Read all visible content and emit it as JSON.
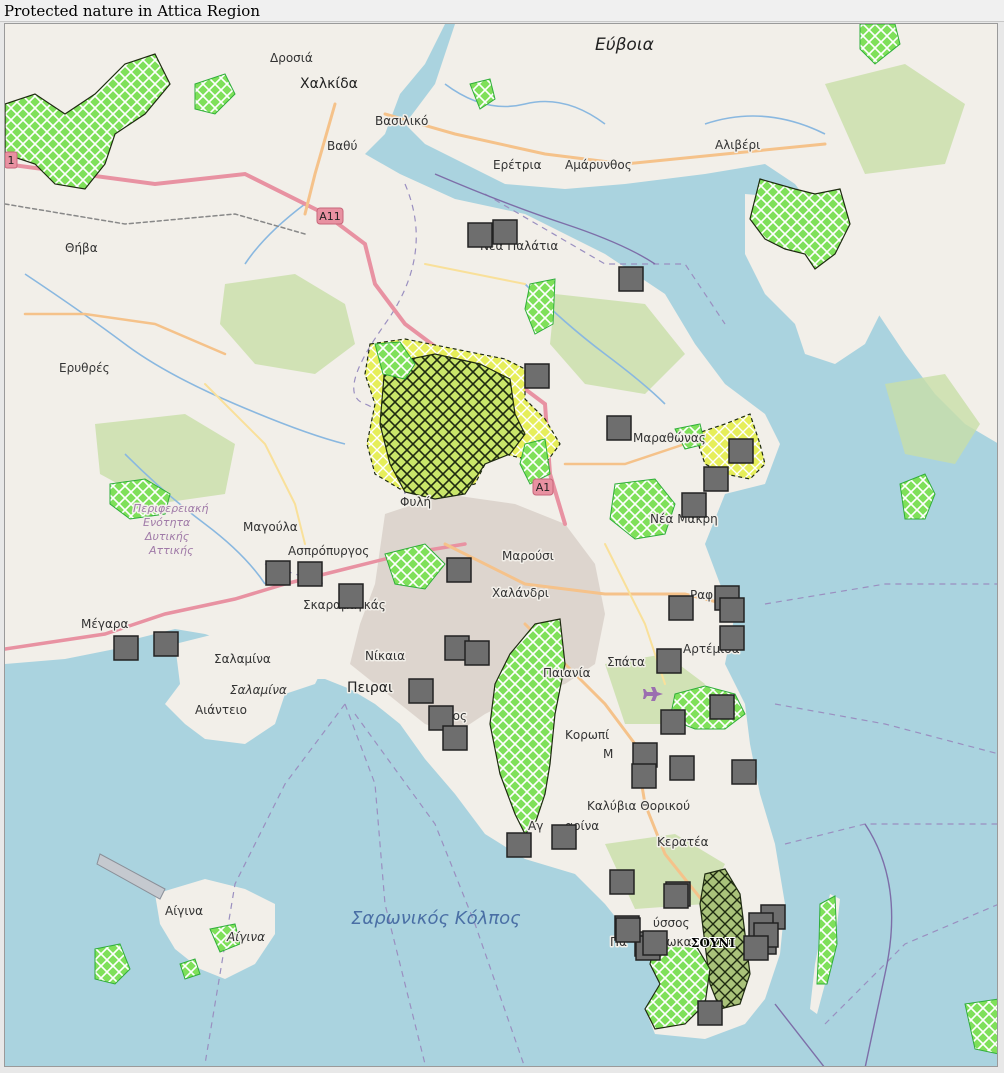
{
  "title": "Protected nature in Attica Region",
  "colors": {
    "sea": "#aad3df",
    "land": "#f2efe9",
    "forest": "#c8dfa8",
    "urban": "#d9d0c9",
    "protected_green": "#7fe05a",
    "protected_yellow": "#eef07a",
    "protected_olive": "#a9c27a",
    "motorway": "#e892a2",
    "marker": "#6e6e6e"
  },
  "map": {
    "place_labels": [
      {
        "id": "evia",
        "text": "Εύβοια",
        "kind": "island"
      },
      {
        "id": "chalkida",
        "text": "Χαλκίδα",
        "kind": "town"
      },
      {
        "id": "drosia",
        "text": "Δροσιά",
        "kind": "place"
      },
      {
        "id": "vasiliko",
        "text": "Βασιλικό",
        "kind": "place"
      },
      {
        "id": "vathy",
        "text": "Βαθύ",
        "kind": "place"
      },
      {
        "id": "eretria",
        "text": "Ερέτρια",
        "kind": "place"
      },
      {
        "id": "amarynthos",
        "text": "Αμάρυνθος",
        "kind": "place"
      },
      {
        "id": "alivery",
        "text": "Αλιβέρι",
        "kind": "place"
      },
      {
        "id": "thiva",
        "text": "Θήβα",
        "kind": "place"
      },
      {
        "id": "nea-palatia",
        "text": "Νέα Παλάτια",
        "kind": "place"
      },
      {
        "id": "erythres",
        "text": "Ερυθρές",
        "kind": "place"
      },
      {
        "id": "marathonas",
        "text": "Μαραθώνας",
        "kind": "place"
      },
      {
        "id": "fyli",
        "text": "Φυλή",
        "kind": "place"
      },
      {
        "id": "nea-makri",
        "text": "Νέα Μάκρη",
        "kind": "place"
      },
      {
        "id": "perif-1",
        "text": "Περιφερειακή",
        "kind": "admin"
      },
      {
        "id": "perif-2",
        "text": "Ενότητα",
        "kind": "admin"
      },
      {
        "id": "perif-3",
        "text": "Δυτικής",
        "kind": "admin"
      },
      {
        "id": "perif-4",
        "text": "Αττικής",
        "kind": "admin"
      },
      {
        "id": "magoula",
        "text": "Μαγούλα",
        "kind": "place"
      },
      {
        "id": "aspropyrgos",
        "text": "Ασπρόπυργος",
        "kind": "place"
      },
      {
        "id": "marousi",
        "text": "Μαρούσι",
        "kind": "place"
      },
      {
        "id": "skaramagkas",
        "text": "Σκαραμαγκάς",
        "kind": "place"
      },
      {
        "id": "chalandri",
        "text": "Χαλάνδρι",
        "kind": "place"
      },
      {
        "id": "rafina",
        "text": "Ραφ",
        "kind": "place"
      },
      {
        "id": "megara",
        "text": "Μέγαρα",
        "kind": "place"
      },
      {
        "id": "salamina-town",
        "text": "Σαλαμίνα",
        "kind": "place"
      },
      {
        "id": "salamina-island",
        "text": "Σαλαμίνα",
        "kind": "island-small"
      },
      {
        "id": "nikaia",
        "text": "Νίκαια",
        "kind": "place"
      },
      {
        "id": "spata",
        "text": "Σπάτα",
        "kind": "place"
      },
      {
        "id": "artemida",
        "text": "Αρτέμιδα",
        "kind": "place"
      },
      {
        "id": "peiraias",
        "text": "Πειραι",
        "kind": "town"
      },
      {
        "id": "paiania",
        "text": "Παιανία",
        "kind": "place"
      },
      {
        "id": "aianteio",
        "text": "Αιάντειο",
        "kind": "place"
      },
      {
        "id": "glyfada",
        "text": "μος",
        "kind": "place"
      },
      {
        "id": "koropi",
        "text": "Κορωπί",
        "kind": "place"
      },
      {
        "id": "markopoulo",
        "text": "Μ",
        "kind": "place"
      },
      {
        "id": "kalyvia",
        "text": "Καλύβια Θορικού",
        "kind": "place"
      },
      {
        "id": "anavyssos-nea",
        "text": "Αγ",
        "kind": "place"
      },
      {
        "id": "varkiza",
        "text": "αρίνα",
        "kind": "place"
      },
      {
        "id": "keratea",
        "text": "Κερατέα",
        "kind": "place"
      },
      {
        "id": "saronic",
        "text": "Σαρωνικός Κόλπος",
        "kind": "sea"
      },
      {
        "id": "aigina-town",
        "text": "Αίγινα",
        "kind": "place"
      },
      {
        "id": "aigina-island",
        "text": "Αίγινα",
        "kind": "island-small"
      },
      {
        "id": "anavyssos",
        "text": "ύσσος",
        "kind": "place"
      },
      {
        "id": "palaia-fokaia",
        "text": "Πα",
        "kind": "place"
      },
      {
        "id": "fokaia",
        "text": "Φωκα",
        "kind": "place"
      },
      {
        "id": "sounio",
        "text": "ΣΟΥΝΙ",
        "kind": "bold"
      },
      {
        "id": "lavrio",
        "text": "ιο",
        "kind": "place"
      }
    ],
    "road_shields": [
      {
        "id": "a11",
        "text": "A11"
      },
      {
        "id": "a1",
        "text": "A1"
      },
      {
        "id": "e-road",
        "text": "1"
      }
    ],
    "markers": [
      {
        "id": "m1"
      },
      {
        "id": "m2"
      },
      {
        "id": "m3"
      },
      {
        "id": "m4"
      },
      {
        "id": "m5"
      },
      {
        "id": "m6"
      },
      {
        "id": "m7"
      },
      {
        "id": "m8"
      },
      {
        "id": "m9"
      },
      {
        "id": "m10"
      },
      {
        "id": "m11"
      },
      {
        "id": "m12"
      },
      {
        "id": "m13"
      },
      {
        "id": "m14"
      },
      {
        "id": "m15"
      },
      {
        "id": "m16"
      },
      {
        "id": "m17"
      },
      {
        "id": "m18"
      },
      {
        "id": "m19"
      },
      {
        "id": "m20"
      },
      {
        "id": "m21"
      },
      {
        "id": "m22"
      },
      {
        "id": "m23"
      },
      {
        "id": "m24"
      },
      {
        "id": "m25"
      },
      {
        "id": "m26"
      },
      {
        "id": "m27"
      },
      {
        "id": "m28"
      },
      {
        "id": "m29"
      },
      {
        "id": "m30"
      },
      {
        "id": "m31"
      },
      {
        "id": "m32"
      },
      {
        "id": "m33"
      },
      {
        "id": "m34"
      },
      {
        "id": "m35"
      },
      {
        "id": "m36"
      },
      {
        "id": "m37"
      },
      {
        "id": "m38"
      },
      {
        "id": "m39"
      },
      {
        "id": "m40"
      },
      {
        "id": "m41"
      },
      {
        "id": "m42"
      },
      {
        "id": "m43"
      },
      {
        "id": "m44"
      },
      {
        "id": "m45"
      },
      {
        "id": "m46"
      },
      {
        "id": "m47"
      }
    ]
  }
}
